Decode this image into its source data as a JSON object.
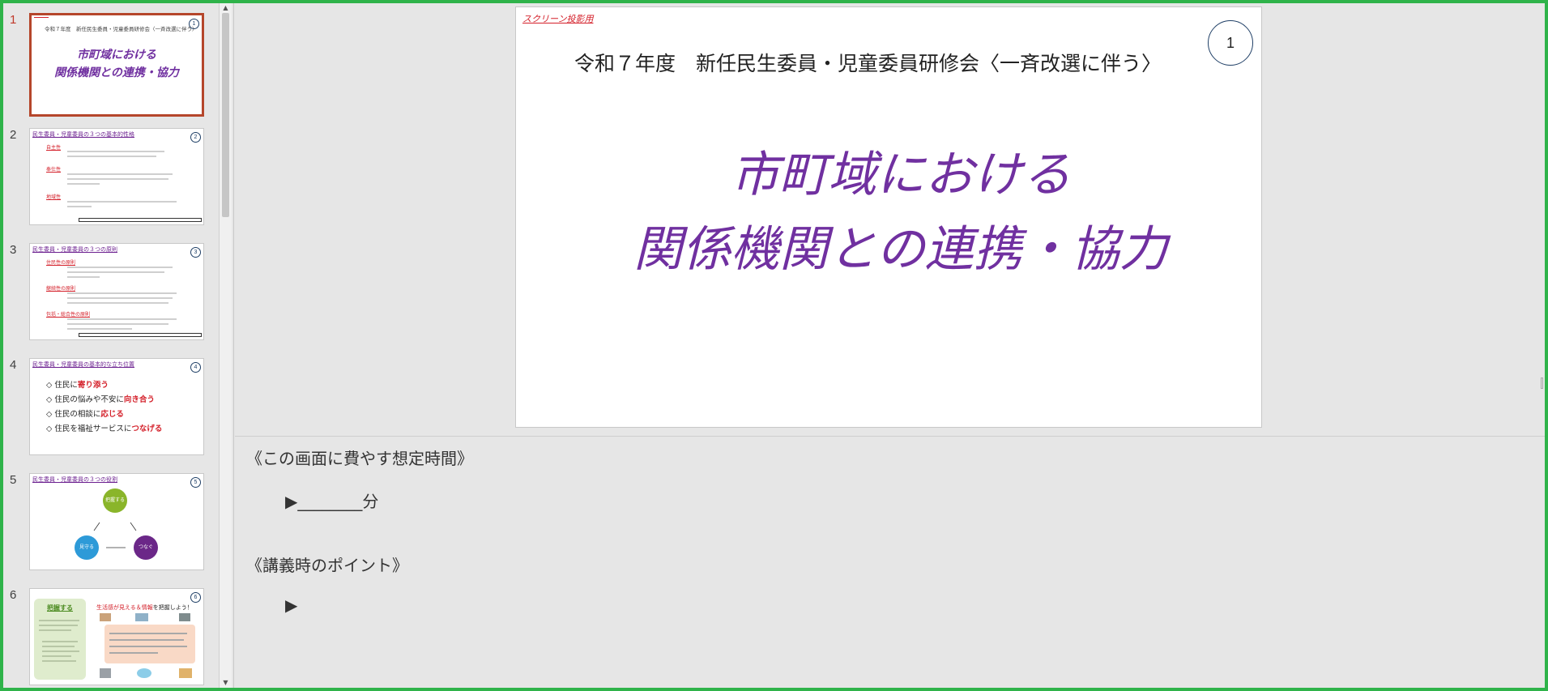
{
  "thumbnails": [
    {
      "number": "1",
      "subtitle": "令和７年度　新任民生委員・児童委員研修会〈一斉改選に伴う〉",
      "title_line1": "市町域における",
      "title_line2": "関係機関との連携・協力",
      "badge": "1"
    },
    {
      "number": "2",
      "heading": "民生委員・児童委員の３つの基本的性格",
      "items": [
        "自主性",
        "奉仕性",
        "地域性"
      ],
      "badge": "2"
    },
    {
      "number": "3",
      "heading": "民生委員・児童委員の３つの原則",
      "items": [
        "住民性の原則",
        "継続性の原則",
        "包括・総合性の原則"
      ],
      "badge": "3"
    },
    {
      "number": "4",
      "heading": "民生委員・児童委員の基本的な立ち位置",
      "bullets": [
        {
          "prefix": "◇ 住民に",
          "emph": "寄り添う",
          "suffix": ""
        },
        {
          "prefix": "◇ 住民の悩みや不安に",
          "emph": "向き合う",
          "suffix": ""
        },
        {
          "prefix": "◇ 住民の相談に",
          "emph": "応じる",
          "suffix": ""
        },
        {
          "prefix": "◇ 住民を福祉サービスに",
          "emph": "つなげる",
          "suffix": ""
        }
      ],
      "badge": "4"
    },
    {
      "number": "5",
      "heading": "民生委員・児童委員の３つの役割",
      "nodes": [
        "把握する",
        "見守る",
        "つなぐ"
      ],
      "badge": "5"
    },
    {
      "number": "6",
      "left_title": "把握する",
      "right_title_a": "生活感が見える",
      "right_title_b": "＆情報",
      "right_title_c": "を把握しよう！",
      "badge": "6"
    }
  ],
  "slide": {
    "screen_label": "スクリーン投影用",
    "number": "1",
    "subtitle": "令和７年度　新任民生委員・児童委員研修会〈一斉改選に伴う〉",
    "title_line1": "市町域における",
    "title_line2": "関係機関との連携・協力"
  },
  "notes": {
    "time_heading": "《この画面に費やす想定時間》",
    "time_value": "▶________分",
    "point_heading": "《講義時のポイント》",
    "point_value": "▶"
  },
  "colors": {
    "frame": "#2fb34a",
    "title": "#7030a0",
    "accent_red": "#d4202a",
    "active_border": "#b5462b"
  }
}
